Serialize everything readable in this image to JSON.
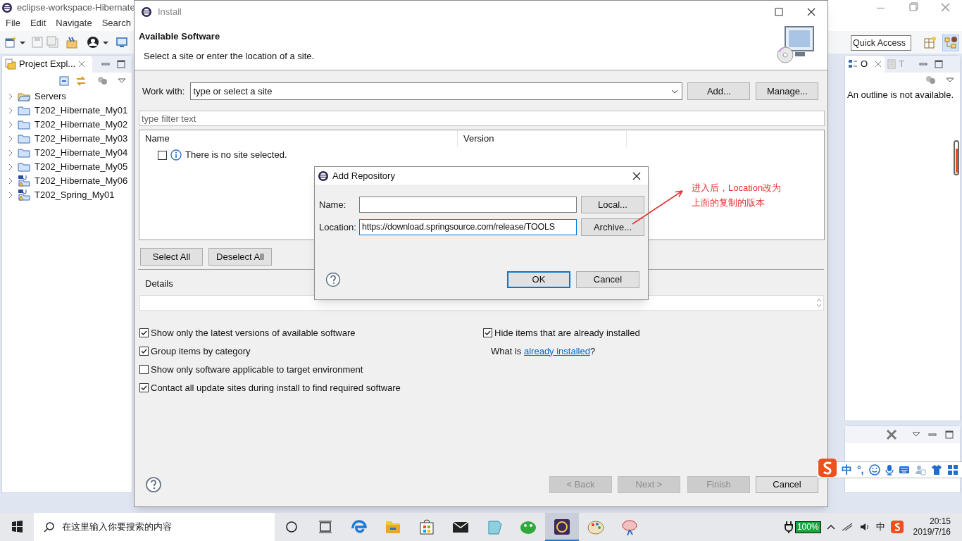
{
  "eclipse": {
    "title": "eclipse-workspace-Hibernate",
    "menu": [
      "File",
      "Edit",
      "Navigate",
      "Search"
    ],
    "quick_access": "Quick Access",
    "project_explorer": {
      "title": "Project Expl...",
      "items": [
        {
          "label": "Servers",
          "kind": "servers"
        },
        {
          "label": "T202_Hibernate_My01",
          "kind": "project"
        },
        {
          "label": "T202_Hibernate_My02",
          "kind": "project"
        },
        {
          "label": "T202_Hibernate_My03",
          "kind": "project"
        },
        {
          "label": "T202_Hibernate_My04",
          "kind": "project"
        },
        {
          "label": "T202_Hibernate_My05",
          "kind": "project"
        },
        {
          "label": "T202_Hibernate_My06",
          "kind": "maven"
        },
        {
          "label": "T202_Spring_My01",
          "kind": "maven"
        }
      ]
    },
    "outline": {
      "tabs": [
        {
          "label": "O",
          "selected": true
        },
        {
          "label": "T",
          "selected": false
        }
      ],
      "message": "An outline is not available."
    }
  },
  "install": {
    "title": "Install",
    "heading": "Available Software",
    "subtitle": "Select a site or enter the location of a site.",
    "work_with": {
      "label": "Work with:",
      "value": "type or select a site"
    },
    "add_button": "Add...",
    "manage_button": "Manage...",
    "filter": {
      "placeholder": "type filter text"
    },
    "table": {
      "columns": [
        "Name",
        "Version"
      ],
      "rows": [
        {
          "label": "There is no site selected.",
          "checked": false
        }
      ]
    },
    "select_all": "Select All",
    "deselect_all": "Deselect All",
    "details_label": "Details",
    "options_left": [
      {
        "label": "Show only the latest versions of available software",
        "checked": true
      },
      {
        "label": "Group items by category",
        "checked": true
      },
      {
        "label": "Show only software applicable to target environment",
        "checked": false
      },
      {
        "label": "Contact all update sites during install to find required software",
        "checked": true
      }
    ],
    "option_right": {
      "label": "Hide items that are already installed",
      "checked": true
    },
    "installed_note": {
      "prefix": "What is ",
      "link": "already installed",
      "suffix": "?"
    },
    "buttons": [
      {
        "label": "< Back",
        "disabled": true
      },
      {
        "label": "Next >",
        "disabled": true
      },
      {
        "label": "Finish",
        "disabled": true
      },
      {
        "label": "Cancel",
        "disabled": false
      }
    ]
  },
  "add_repository": {
    "title": "Add Repository",
    "name": {
      "label": "Name:"
    },
    "local_button": "Local...",
    "location": {
      "label": "Location:",
      "value": "https://download.springsource.com/release/TOOLS"
    },
    "archive_button": "Archive...",
    "buttons": [
      {
        "label": "OK",
        "default": true
      },
      {
        "label": "Cancel",
        "default": false
      }
    ]
  },
  "annotation": {
    "lines": [
      "进入后，Location改为",
      "上面的复制的版本"
    ]
  },
  "ime_bar": {
    "mode": "中",
    "punctuation": "°,"
  },
  "taskbar": {
    "search_placeholder": "在这里输入你要搜索的内容",
    "battery": "100%",
    "input_mode": "中",
    "time": "20:15",
    "date": "2019/7/16"
  }
}
